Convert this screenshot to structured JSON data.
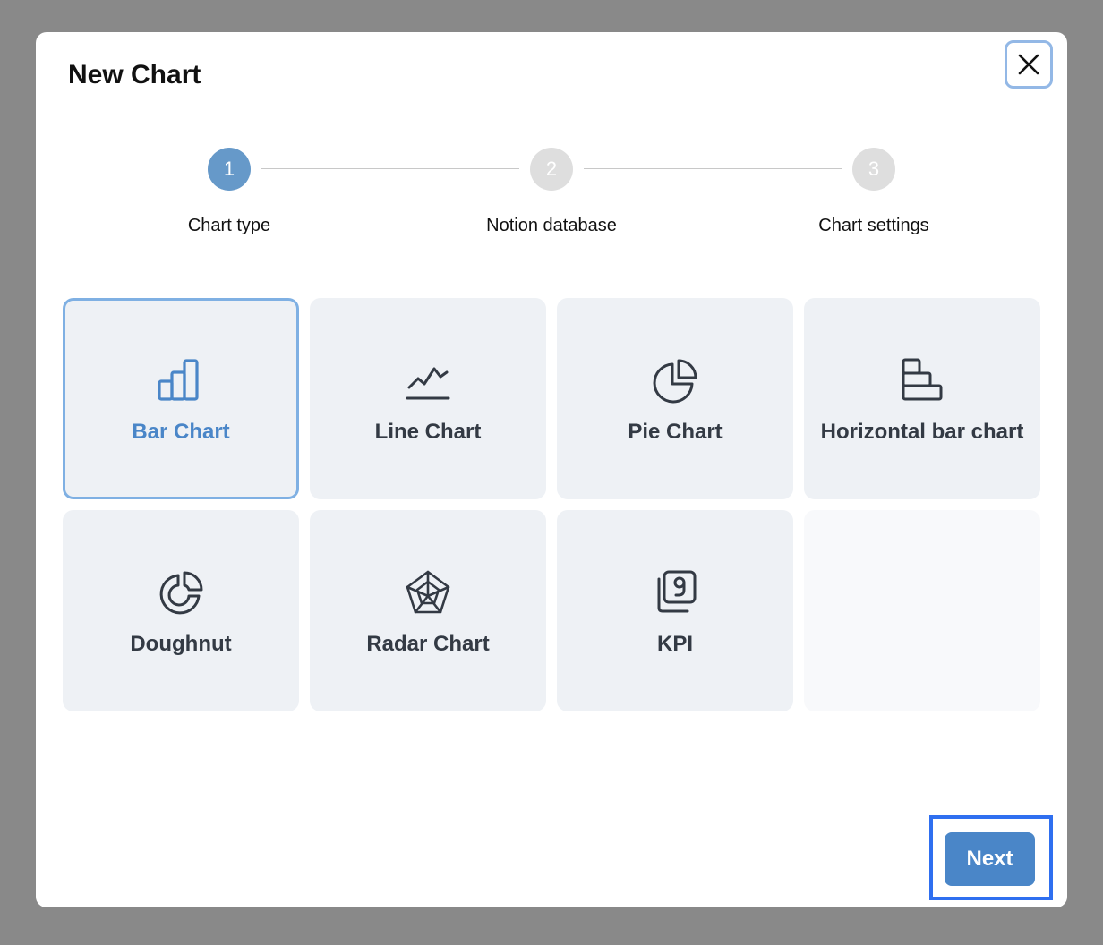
{
  "modal": {
    "title": "New Chart"
  },
  "stepper": {
    "steps": [
      {
        "number": "1",
        "label": "Chart type",
        "active": true
      },
      {
        "number": "2",
        "label": "Notion database",
        "active": false
      },
      {
        "number": "3",
        "label": "Chart settings",
        "active": false
      }
    ]
  },
  "chart_types": [
    {
      "label": "Bar Chart",
      "icon": "bar-chart-icon",
      "selected": true
    },
    {
      "label": "Line Chart",
      "icon": "line-chart-icon",
      "selected": false
    },
    {
      "label": "Pie Chart",
      "icon": "pie-chart-icon",
      "selected": false
    },
    {
      "label": "Horizontal bar chart",
      "icon": "horizontal-bar-chart-icon",
      "selected": false
    },
    {
      "label": "Doughnut",
      "icon": "doughnut-chart-icon",
      "selected": false
    },
    {
      "label": "Radar Chart",
      "icon": "radar-chart-icon",
      "selected": false
    },
    {
      "label": "KPI",
      "icon": "kpi-icon",
      "selected": false
    }
  ],
  "footer": {
    "next_label": "Next"
  },
  "colors": {
    "overlay": "#898989",
    "accent": "#4a86c8",
    "step_active": "#6699c9",
    "step_inactive": "#dedede",
    "card_bg": "#eef1f5",
    "highlight": "#2f6ff0"
  }
}
